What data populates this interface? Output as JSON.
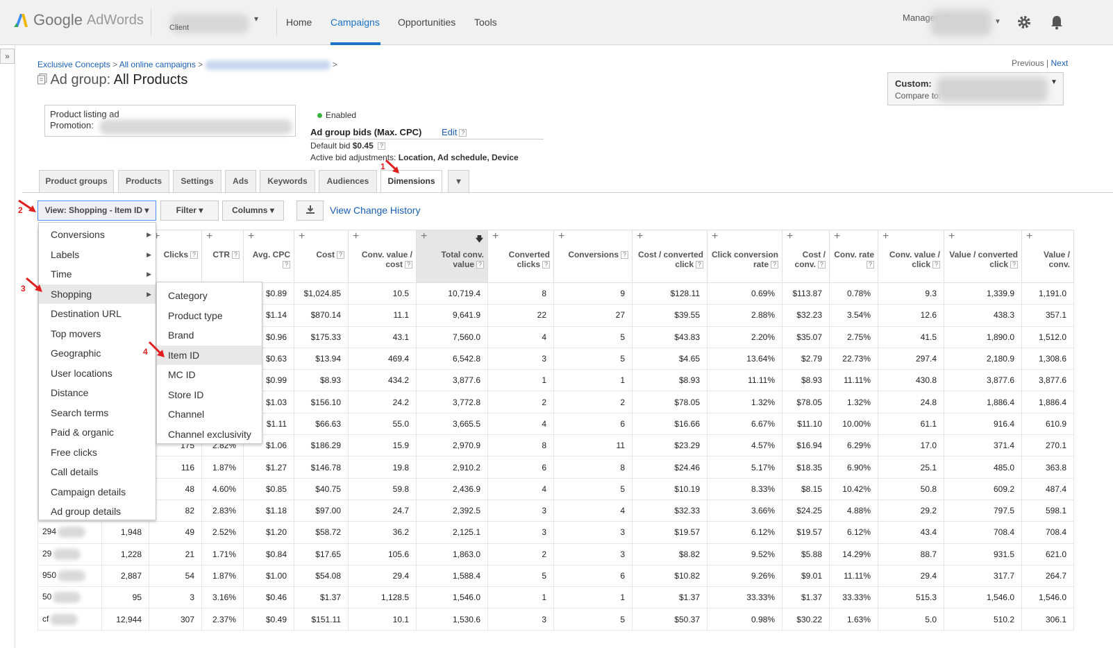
{
  "brand": {
    "google": "Google",
    "adwords": "AdWords"
  },
  "client_label": "Client",
  "nav": {
    "home": "Home",
    "campaigns": "Campaigns",
    "opportunities": "Opportunities",
    "tools": "Tools"
  },
  "manager_id_label": "Manager ID:",
  "breadcrumb": {
    "b1": "Exclusive Concepts",
    "b2": "All online campaigns",
    "sep": ">"
  },
  "page": {
    "prefix": "Ad group:",
    "title": "All Products"
  },
  "prevnext": {
    "previous": "Previous",
    "sep": "|",
    "next": "Next"
  },
  "daterange": {
    "custom": "Custom:",
    "compare": "Compare to:"
  },
  "ad": {
    "line1": "Product listing ad",
    "line2": "Promotion:"
  },
  "status": "Enabled",
  "bids": {
    "title": "Ad group bids (Max. CPC)",
    "edit": "Edit",
    "default_label": "Default bid",
    "default_value": "$0.45",
    "active_label": "Active bid adjustments:",
    "active_value": "Location, Ad schedule, Device"
  },
  "tabs": [
    "Product groups",
    "Products",
    "Settings",
    "Ads",
    "Keywords",
    "Audiences",
    "Dimensions"
  ],
  "toolbar": {
    "view": "View: Shopping - Item ID",
    "filter": "Filter",
    "columns": "Columns",
    "history": "View Change History"
  },
  "steps": [
    "1",
    "2",
    "3",
    "4"
  ],
  "menu_view": [
    "Conversions",
    "Labels",
    "Time",
    "Shopping",
    "Destination URL",
    "Top movers",
    "Geographic",
    "User locations",
    "Distance",
    "Search terms",
    "Paid & organic",
    "Free clicks",
    "Call details",
    "Campaign details",
    "Ad group details"
  ],
  "menu_shopping": [
    "Category",
    "Product type",
    "Brand",
    "Item ID",
    "MC ID",
    "Store ID",
    "Channel",
    "Channel exclusivity"
  ],
  "columns": [
    "",
    "",
    "Clicks",
    "CTR",
    "Avg. CPC",
    "Cost",
    "Conv. value / cost",
    "Total conv. value",
    "Converted clicks",
    "Conversions",
    "Cost / converted click",
    "Click conversion rate",
    "Cost / conv.",
    "Conv. rate",
    "Conv. value / click",
    "Value / converted click",
    "Value / conv."
  ],
  "rows": [
    [
      "",
      "",
      "",
      "",
      "$0.89",
      "$1,024.85",
      "10.5",
      "10,719.4",
      "8",
      "9",
      "$128.11",
      "0.69%",
      "$113.87",
      "0.78%",
      "9.3",
      "1,339.9",
      "1,191.0"
    ],
    [
      "",
      "",
      "",
      "",
      "$1.14",
      "$870.14",
      "11.1",
      "9,641.9",
      "22",
      "27",
      "$39.55",
      "2.88%",
      "$32.23",
      "3.54%",
      "12.6",
      "438.3",
      "357.1"
    ],
    [
      "",
      "",
      "",
      "",
      "$0.96",
      "$175.33",
      "43.1",
      "7,560.0",
      "4",
      "5",
      "$43.83",
      "2.20%",
      "$35.07",
      "2.75%",
      "41.5",
      "1,890.0",
      "1,512.0"
    ],
    [
      "",
      "",
      "",
      "",
      "$0.63",
      "$13.94",
      "469.4",
      "6,542.8",
      "3",
      "5",
      "$4.65",
      "13.64%",
      "$2.79",
      "22.73%",
      "297.4",
      "2,180.9",
      "1,308.6"
    ],
    [
      "",
      "",
      "",
      "",
      "$0.99",
      "$8.93",
      "434.2",
      "3,877.6",
      "1",
      "1",
      "$8.93",
      "11.11%",
      "$8.93",
      "11.11%",
      "430.8",
      "3,877.6",
      "3,877.6"
    ],
    [
      "",
      "",
      "",
      "",
      "$1.03",
      "$156.10",
      "24.2",
      "3,772.8",
      "2",
      "2",
      "$78.05",
      "1.32%",
      "$78.05",
      "1.32%",
      "24.8",
      "1,886.4",
      "1,886.4"
    ],
    [
      "",
      "",
      "",
      "",
      "$1.11",
      "$66.63",
      "55.0",
      "3,665.5",
      "4",
      "6",
      "$16.66",
      "6.67%",
      "$11.10",
      "10.00%",
      "61.1",
      "916.4",
      "610.9"
    ],
    [
      "",
      "",
      "175",
      "2.82%",
      "$1.06",
      "$186.29",
      "15.9",
      "2,970.9",
      "8",
      "11",
      "$23.29",
      "4.57%",
      "$16.94",
      "6.29%",
      "17.0",
      "371.4",
      "270.1"
    ],
    [
      "",
      "",
      "116",
      "1.87%",
      "$1.27",
      "$146.78",
      "19.8",
      "2,910.2",
      "6",
      "8",
      "$24.46",
      "5.17%",
      "$18.35",
      "6.90%",
      "25.1",
      "485.0",
      "363.8"
    ],
    [
      "",
      "",
      "48",
      "4.60%",
      "$0.85",
      "$40.75",
      "59.8",
      "2,436.9",
      "4",
      "5",
      "$10.19",
      "8.33%",
      "$8.15",
      "10.42%",
      "50.8",
      "609.2",
      "487.4"
    ],
    [
      "",
      "",
      "82",
      "2.83%",
      "$1.18",
      "$97.00",
      "24.7",
      "2,392.5",
      "3",
      "4",
      "$32.33",
      "3.66%",
      "$24.25",
      "4.88%",
      "29.2",
      "797.5",
      "598.1"
    ],
    [
      "294",
      "1,948",
      "49",
      "2.52%",
      "$1.20",
      "$58.72",
      "36.2",
      "2,125.1",
      "3",
      "3",
      "$19.57",
      "6.12%",
      "$19.57",
      "6.12%",
      "43.4",
      "708.4",
      "708.4"
    ],
    [
      "29",
      "1,228",
      "21",
      "1.71%",
      "$0.84",
      "$17.65",
      "105.6",
      "1,863.0",
      "2",
      "3",
      "$8.82",
      "9.52%",
      "$5.88",
      "14.29%",
      "88.7",
      "931.5",
      "621.0"
    ],
    [
      "950",
      "2,887",
      "54",
      "1.87%",
      "$1.00",
      "$54.08",
      "29.4",
      "1,588.4",
      "5",
      "6",
      "$10.82",
      "9.26%",
      "$9.01",
      "11.11%",
      "29.4",
      "317.7",
      "264.7"
    ],
    [
      "50",
      "95",
      "3",
      "3.16%",
      "$0.46",
      "$1.37",
      "1,128.5",
      "1,546.0",
      "1",
      "1",
      "$1.37",
      "33.33%",
      "$1.37",
      "33.33%",
      "515.3",
      "1,546.0",
      "1,546.0"
    ],
    [
      "cf",
      "12,944",
      "307",
      "2.37%",
      "$0.49",
      "$151.11",
      "10.1",
      "1,530.6",
      "3",
      "5",
      "$50.37",
      "0.98%",
      "$30.22",
      "1.63%",
      "5.0",
      "510.2",
      "306.1"
    ]
  ],
  "colors": {
    "link": "#1a5fb4",
    "active_nav": "#1a73c8",
    "annotation": "#e02020",
    "enabled": "#3bb13b"
  }
}
